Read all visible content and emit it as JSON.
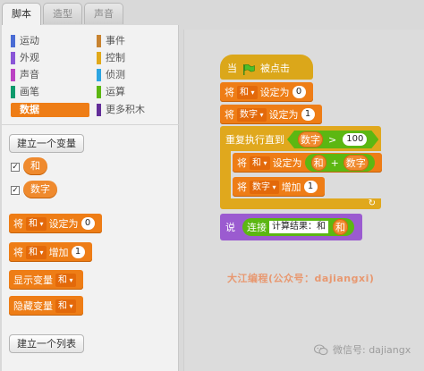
{
  "tabs": [
    "脚本",
    "造型",
    "声音"
  ],
  "categories_left": [
    {
      "label": "运动",
      "color": "#4a6cd4"
    },
    {
      "label": "外观",
      "color": "#8a55d7"
    },
    {
      "label": "声音",
      "color": "#bb42c3"
    },
    {
      "label": "画笔",
      "color": "#0e9a6c"
    },
    {
      "label": "数据",
      "color": "#ee7d16"
    }
  ],
  "categories_right": [
    {
      "label": "事件",
      "color": "#c88330"
    },
    {
      "label": "控制",
      "color": "#e1a91a"
    },
    {
      "label": "侦测",
      "color": "#2ca5e2"
    },
    {
      "label": "运算",
      "color": "#5cb712"
    },
    {
      "label": "更多积木",
      "color": "#632d99"
    }
  ],
  "palette": {
    "make_variable": "建立一个变量",
    "var_he": "和",
    "var_shuzi": "数字",
    "set_block": {
      "prefix": "将",
      "var": "和",
      "mid": "设定为",
      "value": "0"
    },
    "change_block": {
      "prefix": "将",
      "var": "和",
      "mid": "增加",
      "value": "1"
    },
    "show_block": {
      "label": "显示变量",
      "var": "和"
    },
    "hide_block": {
      "label": "隐藏变量",
      "var": "和"
    },
    "make_list": "建立一个列表"
  },
  "script": {
    "hat": {
      "prefix": "当",
      "suffix": "被点击"
    },
    "set1": {
      "prefix": "将",
      "var": "和",
      "mid": "设定为",
      "value": "0"
    },
    "set2": {
      "prefix": "将",
      "var": "数字",
      "mid": "设定为",
      "value": "1"
    },
    "repeat": {
      "label": "重复执行直到",
      "var": "数字",
      "op": ">",
      "value": "100"
    },
    "inner_set": {
      "prefix": "将",
      "var": "和",
      "mid": "设定为",
      "a": "和",
      "op": "+",
      "b": "数字"
    },
    "inner_change": {
      "prefix": "将",
      "var": "数字",
      "mid": "增加",
      "value": "1"
    },
    "say": {
      "label": "说",
      "join": "连接",
      "text": "计算结果：和",
      "var": "和"
    },
    "loop_arrow": "↻"
  },
  "watermark": "大江编程(公众号：dajiangxi)",
  "wechat": "微信号: dajiangx",
  "colors": {
    "data": "#ee7d16",
    "control": "#e1a91a",
    "events": "#dba71a",
    "looks": "#9b5bd0",
    "operators": "#5cb712"
  }
}
